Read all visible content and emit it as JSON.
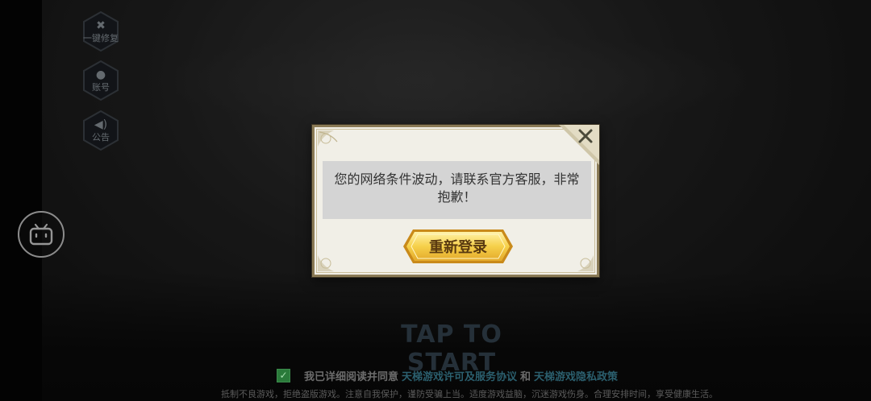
{
  "side_buttons": [
    {
      "name": "repair",
      "icon": "wrench-hammer-icon",
      "label": "一键修复"
    },
    {
      "name": "account",
      "icon": "user-icon",
      "label": "账号"
    },
    {
      "name": "notice",
      "icon": "speaker-icon",
      "label": "公告"
    }
  ],
  "bilibili_button": {
    "icon": "bilibili-tv-icon"
  },
  "background": {
    "tap_to_start": "TAP TO START"
  },
  "agreement": {
    "checked": true,
    "prefix": "我已详细阅读并同意",
    "license_link": "天梯游戏许可及服务协议",
    "and": "和",
    "privacy_link": "天梯游戏隐私政策"
  },
  "health_notice": "抵制不良游戏，拒绝盗版游戏。注意自我保护，谨防受骗上当。适度游戏益脑，沉迷游戏伤身。合理安排时间，享受健康生活。",
  "dialog": {
    "message": "您的网络条件波动，请联系官方客服，非常抱歉！",
    "button_label": "重新登录",
    "close_icon": "close-icon"
  },
  "colors": {
    "dialog_bg": "#f1efe7",
    "dialog_border": "#8a7a55",
    "button_gold": "#f3c73e",
    "link": "#2b5f6e",
    "checkbox": "#2a7a3a"
  }
}
